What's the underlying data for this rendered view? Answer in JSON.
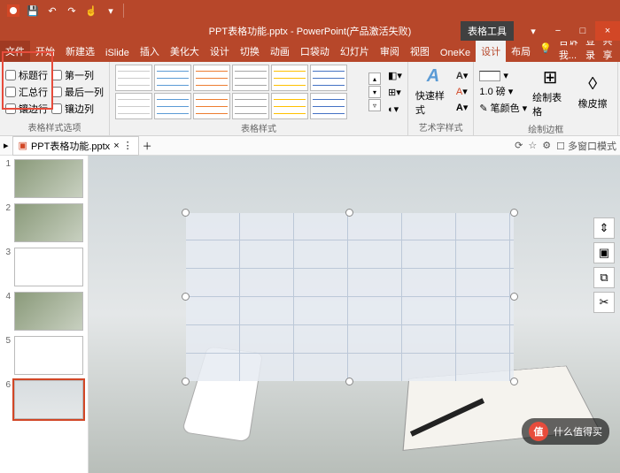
{
  "qat": {
    "items": [
      "save",
      "undo",
      "redo",
      "touch",
      "more"
    ]
  },
  "title": {
    "filename": "PPT表格功能.pptx",
    "app": "PowerPoint",
    "status": "产品激活失败",
    "tabtool": "表格工具"
  },
  "wincontrols": {
    "min": "−",
    "max": "□",
    "close": "×",
    "ribbon_opts": "▾"
  },
  "tabs": {
    "file": "文件",
    "list": [
      "开始",
      "新建选",
      "iSlide",
      "插入",
      "美化大",
      "设计",
      "切换",
      "动画",
      "口袋动",
      "幻灯片",
      "审阅",
      "视图",
      "OneKe",
      "设计",
      "布局"
    ],
    "active_index": 13,
    "tell": "告诉我...",
    "login": "登录",
    "share": "共享"
  },
  "table_options": {
    "header_row": "标题行",
    "total_row": "汇总行",
    "banded_row": "镶边行",
    "first_col": "第一列",
    "last_col": "最后一列",
    "banded_col": "镶边列",
    "label": "表格样式选项"
  },
  "groups": {
    "styles": "表格样式",
    "wordart": "艺术字样式",
    "border": "绘制边框"
  },
  "wordart": {
    "quick": "快速样式"
  },
  "border": {
    "weight": "1.0 磅",
    "pencolor": "笔颜色",
    "draw": "绘制表格",
    "eraser": "橡皮擦"
  },
  "doctab": {
    "name": "PPT表格功能.pptx",
    "multiwindow": "多窗口模式"
  },
  "slides": {
    "count": 6,
    "selected": 6
  },
  "watermark": {
    "text": "什么值得买",
    "badge": "值"
  }
}
